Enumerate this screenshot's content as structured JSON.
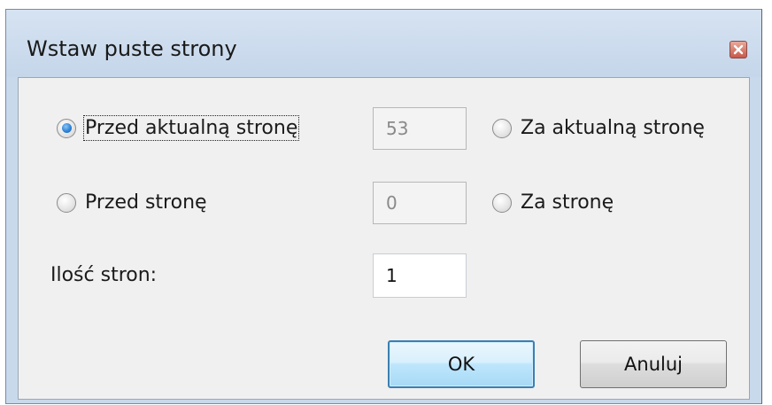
{
  "dialog": {
    "title": "Wstaw puste strony",
    "close_icon": "close-icon"
  },
  "options": {
    "before_current": {
      "label": "Przed aktualną stronę",
      "selected": true,
      "page_value": "53"
    },
    "after_current": {
      "label": "Za aktualną stronę",
      "selected": false
    },
    "before_page": {
      "label": "Przed stronę",
      "selected": false,
      "page_value": "0"
    },
    "after_page": {
      "label": "Za stronę",
      "selected": false
    }
  },
  "page_count": {
    "label": "Ilość stron:",
    "value": "1"
  },
  "buttons": {
    "ok_label": "OK",
    "cancel_label": "Anuluj"
  },
  "colors": {
    "title_bar": "#c9d9ec",
    "client_bg": "#f0f0f0",
    "close_button": "#c8594a",
    "ok_border": "#3c7fb1",
    "radio_dot": "#2f83d6"
  }
}
